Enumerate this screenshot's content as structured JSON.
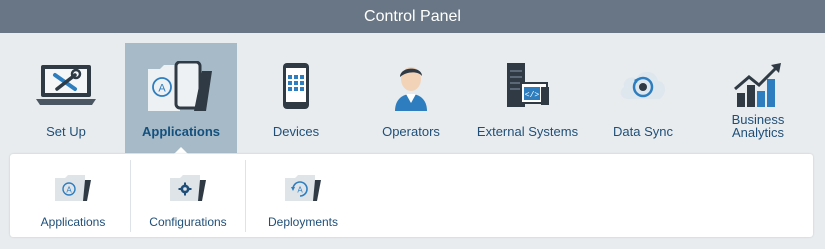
{
  "header": {
    "title": "Control Panel"
  },
  "toolbar": {
    "items": [
      {
        "label": "Set Up",
        "icon": "laptop-tools-icon"
      },
      {
        "label": "Applications",
        "icon": "applications-folder-icon",
        "active": true
      },
      {
        "label": "Devices",
        "icon": "mobile-device-icon"
      },
      {
        "label": "Operators",
        "icon": "operator-avatar-icon"
      },
      {
        "label": "External Systems",
        "icon": "external-systems-icon"
      },
      {
        "label": "Data Sync",
        "icon": "data-sync-icon"
      },
      {
        "label": "Business Analytics",
        "icon": "analytics-chart-icon"
      }
    ]
  },
  "subpanel": {
    "items": [
      {
        "label": "Applications",
        "icon": "applications-folder-icon"
      },
      {
        "label": "Configurations",
        "icon": "configurations-folder-icon"
      },
      {
        "label": "Deployments",
        "icon": "deployments-folder-icon"
      }
    ]
  },
  "colors": {
    "header_bg": "#687685",
    "active_tab_bg": "#a7bac8",
    "label_blue": "#1f4f78",
    "accent_blue": "#2e7ebf",
    "icon_dark": "#2f3a45"
  }
}
